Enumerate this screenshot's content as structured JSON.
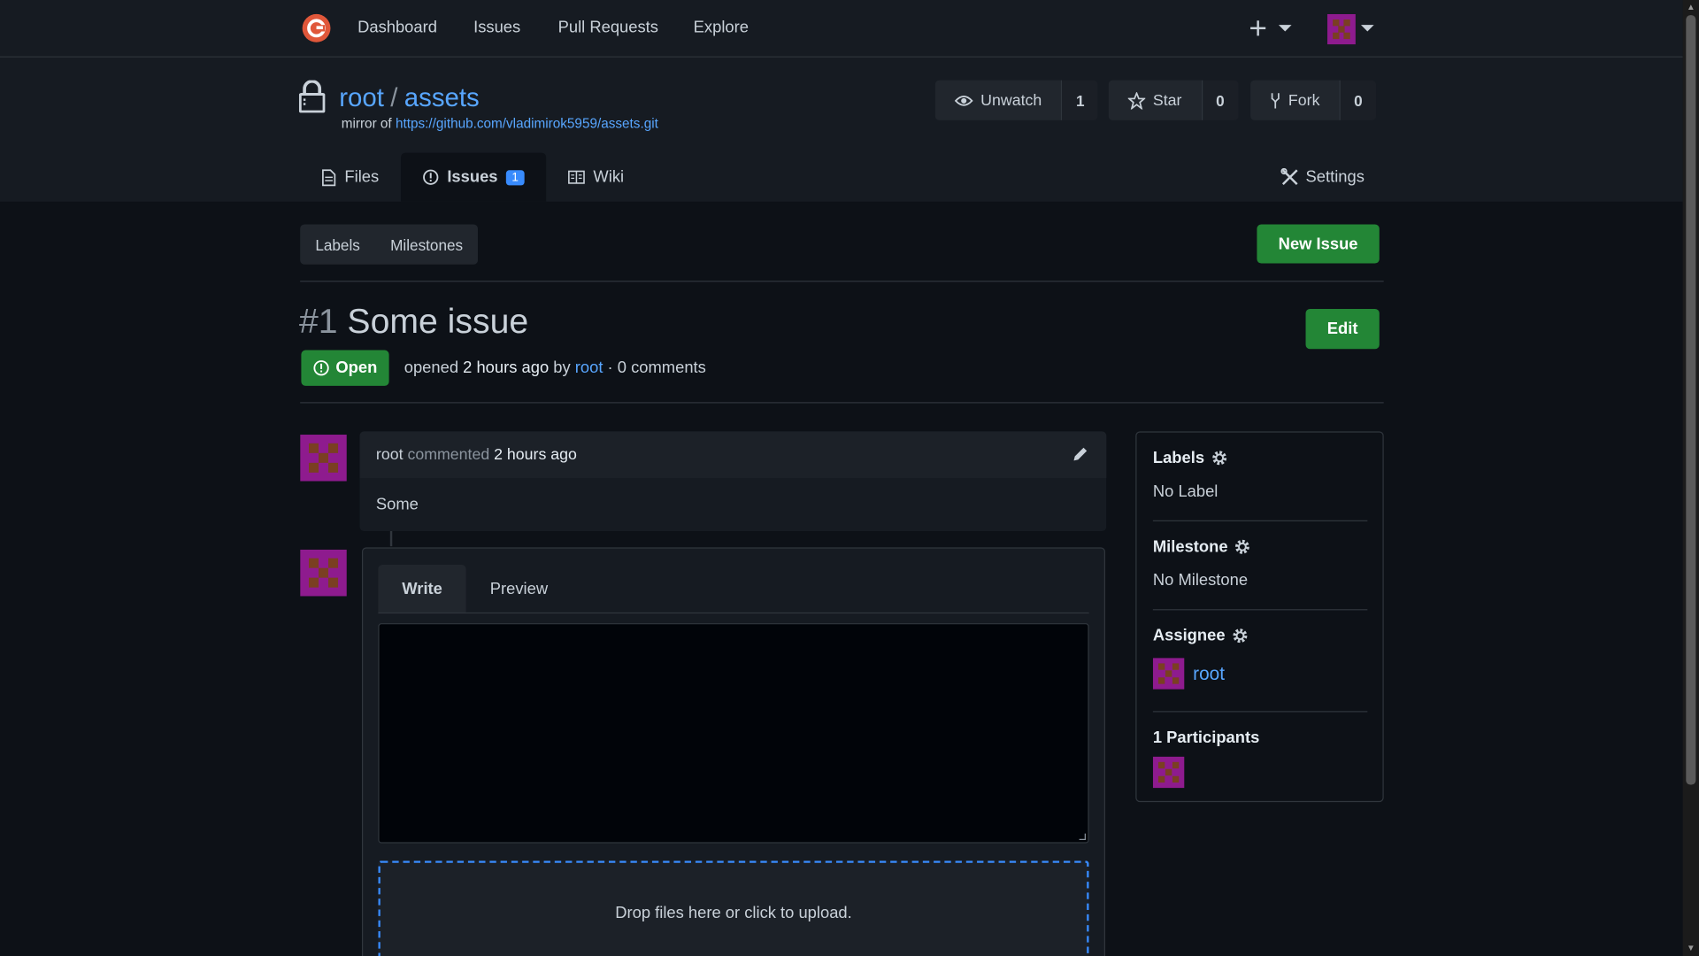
{
  "nav": {
    "items": [
      "Dashboard",
      "Issues",
      "Pull Requests",
      "Explore"
    ]
  },
  "repo": {
    "owner": "root",
    "separator": "/",
    "name": "assets",
    "mirror_prefix": "mirror of",
    "mirror_url": "https://github.com/vladimirok5959/assets.git",
    "unwatch_label": "Unwatch",
    "watch_count": "1",
    "star_label": "Star",
    "star_count": "0",
    "fork_label": "Fork",
    "fork_count": "0"
  },
  "tabs": {
    "files": "Files",
    "issues": "Issues",
    "issues_count": "1",
    "wiki": "Wiki",
    "settings": "Settings"
  },
  "submenu": {
    "labels": "Labels",
    "milestones": "Milestones",
    "new_issue": "New Issue"
  },
  "issue": {
    "number": "#1",
    "title": "Some issue",
    "edit_label": "Edit",
    "status": "Open",
    "opened_text": "opened",
    "time_ago": "2 hours ago",
    "by_text": "by",
    "author": "root",
    "comments": "· 0 comments"
  },
  "comment": {
    "author": "root",
    "verb": "commented",
    "time": "2 hours ago",
    "body": "Some"
  },
  "editor": {
    "write_tab": "Write",
    "preview_tab": "Preview",
    "dropzone_text": "Drop files here or click to upload."
  },
  "sidebar": {
    "labels_title": "Labels",
    "labels_value": "No Label",
    "milestone_title": "Milestone",
    "milestone_value": "No Milestone",
    "assignee_title": "Assignee",
    "assignee_name": "root",
    "participants_title": "1 Participants"
  },
  "colors": {
    "accent_green": "#238636",
    "link_blue": "#58a6ff",
    "avatar_magenta": "#8e1b8e",
    "background": "#0d1117"
  }
}
